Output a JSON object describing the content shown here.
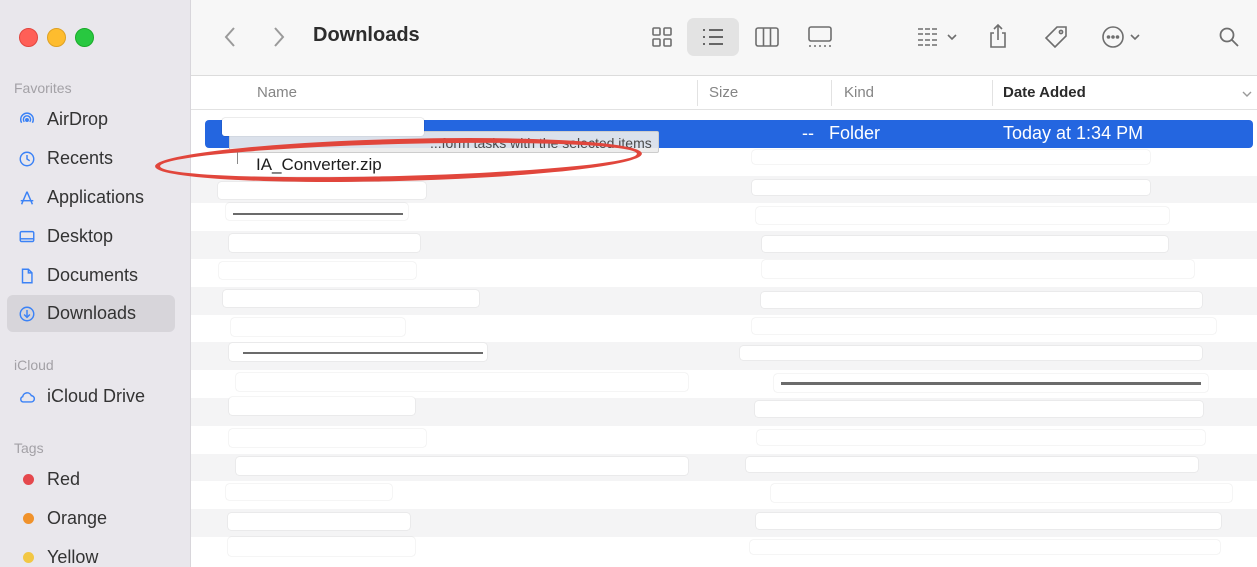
{
  "window": {
    "title": "Downloads"
  },
  "sidebar": {
    "sections": {
      "favorites": "Favorites",
      "icloud": "iCloud",
      "tags": "Tags"
    },
    "favorites": [
      {
        "label": "AirDrop",
        "icon": "airdrop-icon"
      },
      {
        "label": "Recents",
        "icon": "clock-icon"
      },
      {
        "label": "Applications",
        "icon": "applications-icon"
      },
      {
        "label": "Desktop",
        "icon": "desktop-icon"
      },
      {
        "label": "Documents",
        "icon": "document-icon"
      },
      {
        "label": "Downloads",
        "icon": "download-icon",
        "active": true
      }
    ],
    "icloud": [
      {
        "label": "iCloud Drive",
        "icon": "cloud-icon"
      }
    ],
    "tags": [
      {
        "label": "Red",
        "color": "#e5484d"
      },
      {
        "label": "Orange",
        "color": "#f0922b"
      },
      {
        "label": "Yellow",
        "color": "#f2c744"
      }
    ]
  },
  "toolbar": {
    "back_icon": "chevron-left-icon",
    "forward_icon": "chevron-right-icon",
    "view_modes": [
      "icon-view-icon",
      "list-view-icon",
      "column-view-icon",
      "gallery-view-icon"
    ],
    "active_view": "list-view-icon",
    "actions": [
      "group-icon",
      "share-icon",
      "tag-icon",
      "more-icon",
      "search-icon"
    ]
  },
  "columns": {
    "name": "Name",
    "size": "Size",
    "kind": "Kind",
    "date_added": "Date Added"
  },
  "selected_row": {
    "size": "--",
    "kind": "Folder",
    "date_added": "Today at 1:34 PM"
  },
  "drag_tooltip": "...form tasks with the selected items",
  "highlighted_file": "IA_Converter.zip",
  "colors": {
    "selection": "#2466e0",
    "annotation": "#e1463c",
    "close": "#ff5f57",
    "minimize": "#febc2e",
    "maximize": "#28c840"
  }
}
